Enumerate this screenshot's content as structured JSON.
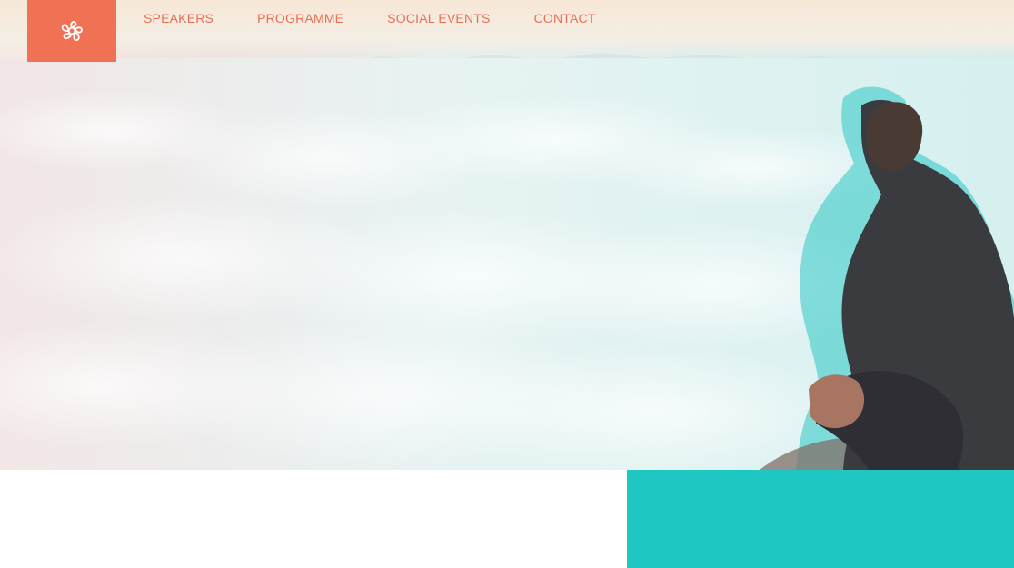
{
  "header": {
    "logo_icon": "flower-icon",
    "accent_color": "#f07154",
    "nav": [
      {
        "label": "SPEAKERS"
      },
      {
        "label": "PROGRAMME"
      },
      {
        "label": "SOCIAL EVENTS"
      },
      {
        "label": "CONTACT"
      }
    ]
  },
  "hero": {
    "image": "person-sitting-above-clouds"
  },
  "footer_block": {
    "color": "#1fc7c3"
  }
}
